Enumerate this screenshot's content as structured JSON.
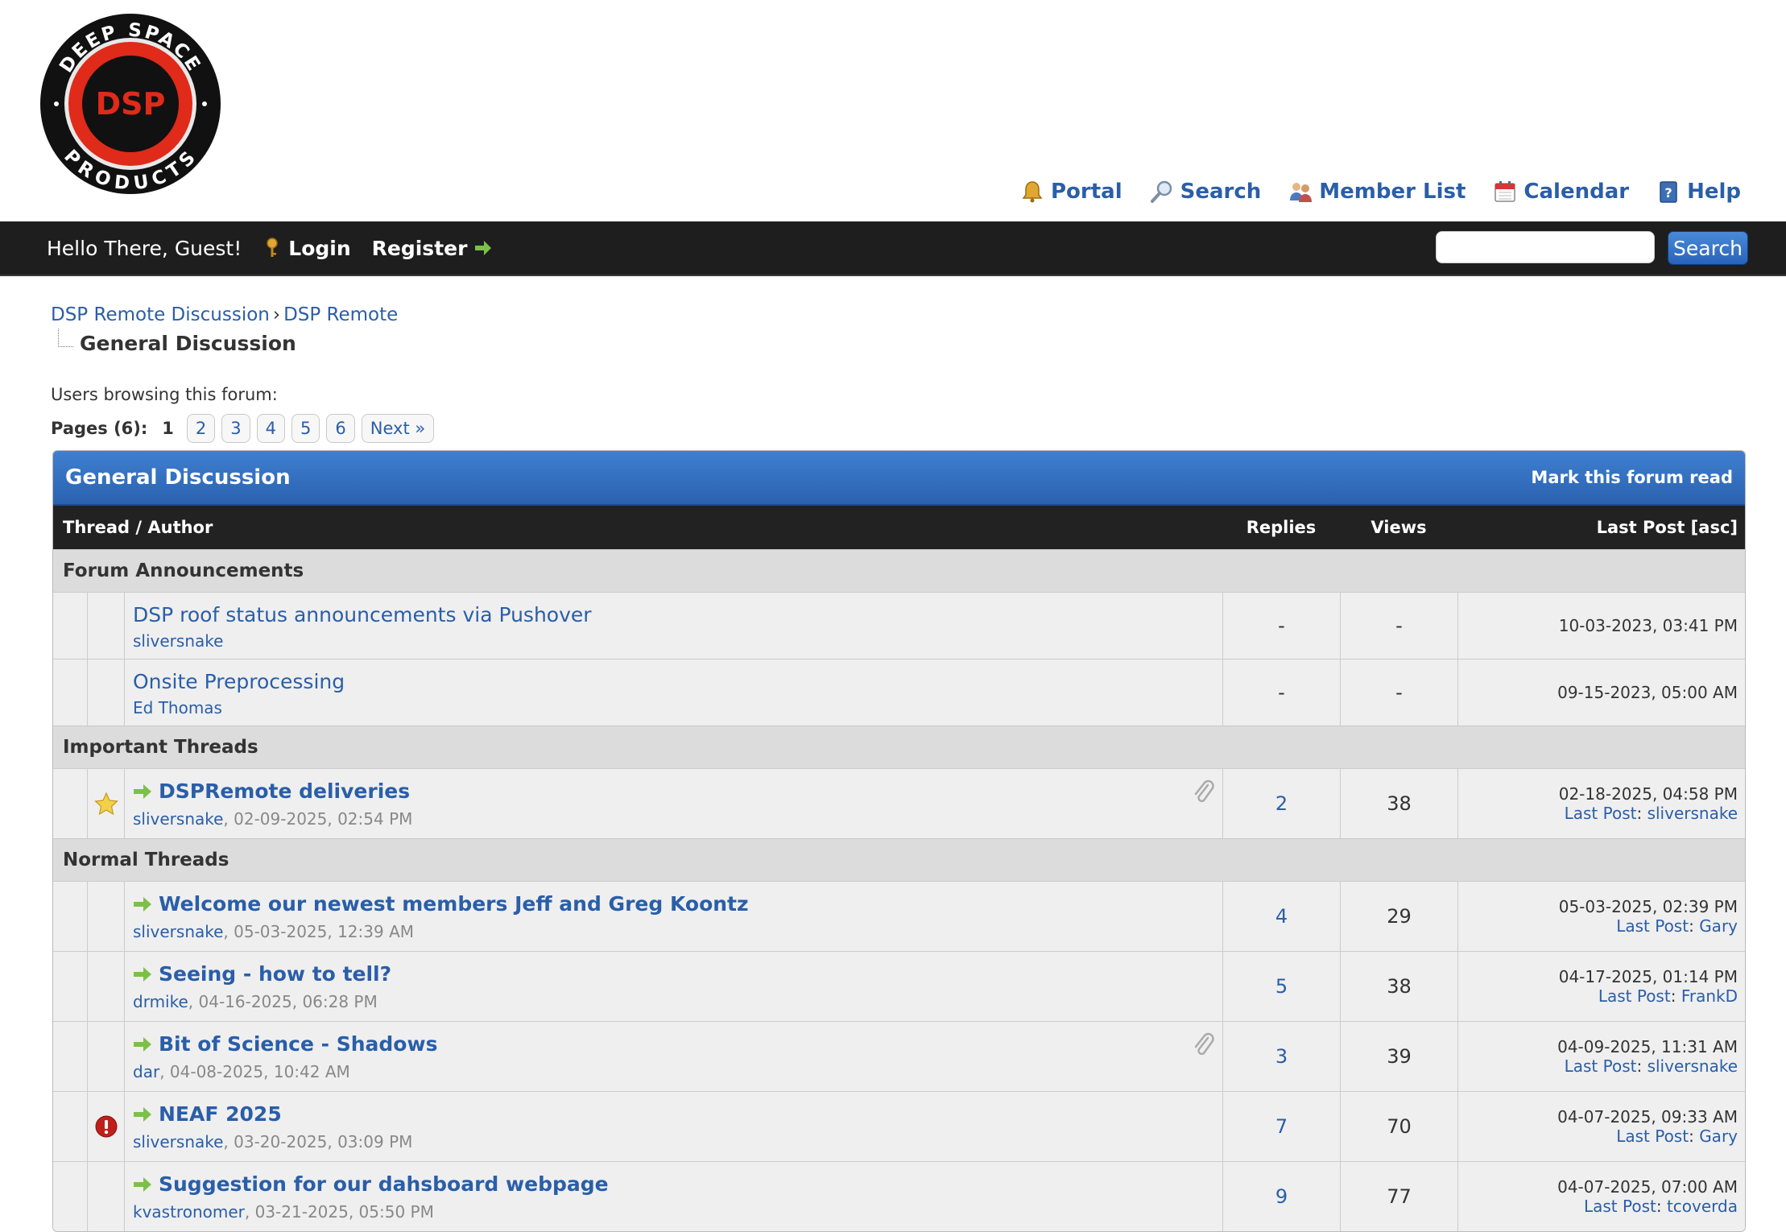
{
  "logo": {
    "ring_top": "DEEP SPACE",
    "ring_bottom": "PRODUCTS",
    "center": "DSP"
  },
  "toplinks": [
    {
      "label": "Portal",
      "icon": "bell-icon"
    },
    {
      "label": "Search",
      "icon": "magnifier-icon"
    },
    {
      "label": "Member List",
      "icon": "members-icon"
    },
    {
      "label": "Calendar",
      "icon": "calendar-icon"
    },
    {
      "label": "Help",
      "icon": "help-book-icon"
    }
  ],
  "panel": {
    "welcome": "Hello There, Guest!",
    "login": "Login",
    "register": "Register",
    "search_button": "Search",
    "search_value": ""
  },
  "breadcrumb": {
    "items": [
      "DSP Remote Discussion",
      "DSP Remote"
    ],
    "separator": "›",
    "current": "General Discussion"
  },
  "browsing": "Users browsing this forum:",
  "pagination": {
    "label": "Pages (6):",
    "current": "1",
    "pages": [
      "2",
      "3",
      "4",
      "5",
      "6"
    ],
    "next": "Next »"
  },
  "forum": {
    "title": "General Discussion",
    "mark_read": "Mark this forum read",
    "columns": {
      "thread": "Thread / Author",
      "replies": "Replies",
      "views": "Views",
      "lastpost": "Last Post [asc]"
    },
    "sections": {
      "announcements": "Forum Announcements",
      "important": "Important Threads",
      "normal": "Normal Threads"
    },
    "announcements": [
      {
        "subject": "DSP roof status announcements via Pushover",
        "author": "sliversnake",
        "replies": "-",
        "views": "-",
        "lastpost": "10-03-2023, 03:41 PM"
      },
      {
        "subject": "Onsite Preprocessing",
        "author": "Ed Thomas",
        "replies": "-",
        "views": "-",
        "lastpost": "09-15-2023, 05:00 AM"
      }
    ],
    "threads": [
      {
        "subject": "DSPRemote deliveries",
        "author": "sliversnake",
        "date": ", 02-09-2025, 02:54 PM",
        "replies": "2",
        "views": "38",
        "lastpost_date": "02-18-2025, 04:58 PM",
        "lastpost_label": "Last Post",
        "lastpost_user": "sliversnake",
        "status_icon": "star-icon",
        "attachment": true
      },
      {
        "subject": "Welcome our newest members Jeff and Greg Koontz",
        "author": "sliversnake",
        "date": ", 05-03-2025, 12:39 AM",
        "replies": "4",
        "views": "29",
        "lastpost_date": "05-03-2025, 02:39 PM",
        "lastpost_label": "Last Post",
        "lastpost_user": "Gary",
        "status_icon": "",
        "attachment": false
      },
      {
        "subject": "Seeing - how to tell?",
        "author": "drmike",
        "date": ", 04-16-2025, 06:28 PM",
        "replies": "5",
        "views": "38",
        "lastpost_date": "04-17-2025, 01:14 PM",
        "lastpost_label": "Last Post",
        "lastpost_user": "FrankD",
        "status_icon": "",
        "attachment": false
      },
      {
        "subject": "Bit of Science - Shadows",
        "author": "dar",
        "date": ", 04-08-2025, 10:42 AM",
        "replies": "3",
        "views": "39",
        "lastpost_date": "04-09-2025, 11:31 AM",
        "lastpost_label": "Last Post",
        "lastpost_user": "sliversnake",
        "status_icon": "",
        "attachment": true
      },
      {
        "subject": "NEAF 2025",
        "author": "sliversnake",
        "date": ", 03-20-2025, 03:09 PM",
        "replies": "7",
        "views": "70",
        "lastpost_date": "04-07-2025, 09:33 AM",
        "lastpost_label": "Last Post",
        "lastpost_user": "Gary",
        "status_icon": "exclamation-icon",
        "attachment": false
      },
      {
        "subject": "Suggestion for our dahsboard webpage",
        "author": "kvastronomer",
        "date": ", 03-21-2025, 05:50 PM",
        "replies": "9",
        "views": "77",
        "lastpost_date": "04-07-2025, 07:00 AM",
        "lastpost_label": "Last Post",
        "lastpost_user": "tcoverda",
        "status_icon": "",
        "attachment": false
      }
    ]
  }
}
